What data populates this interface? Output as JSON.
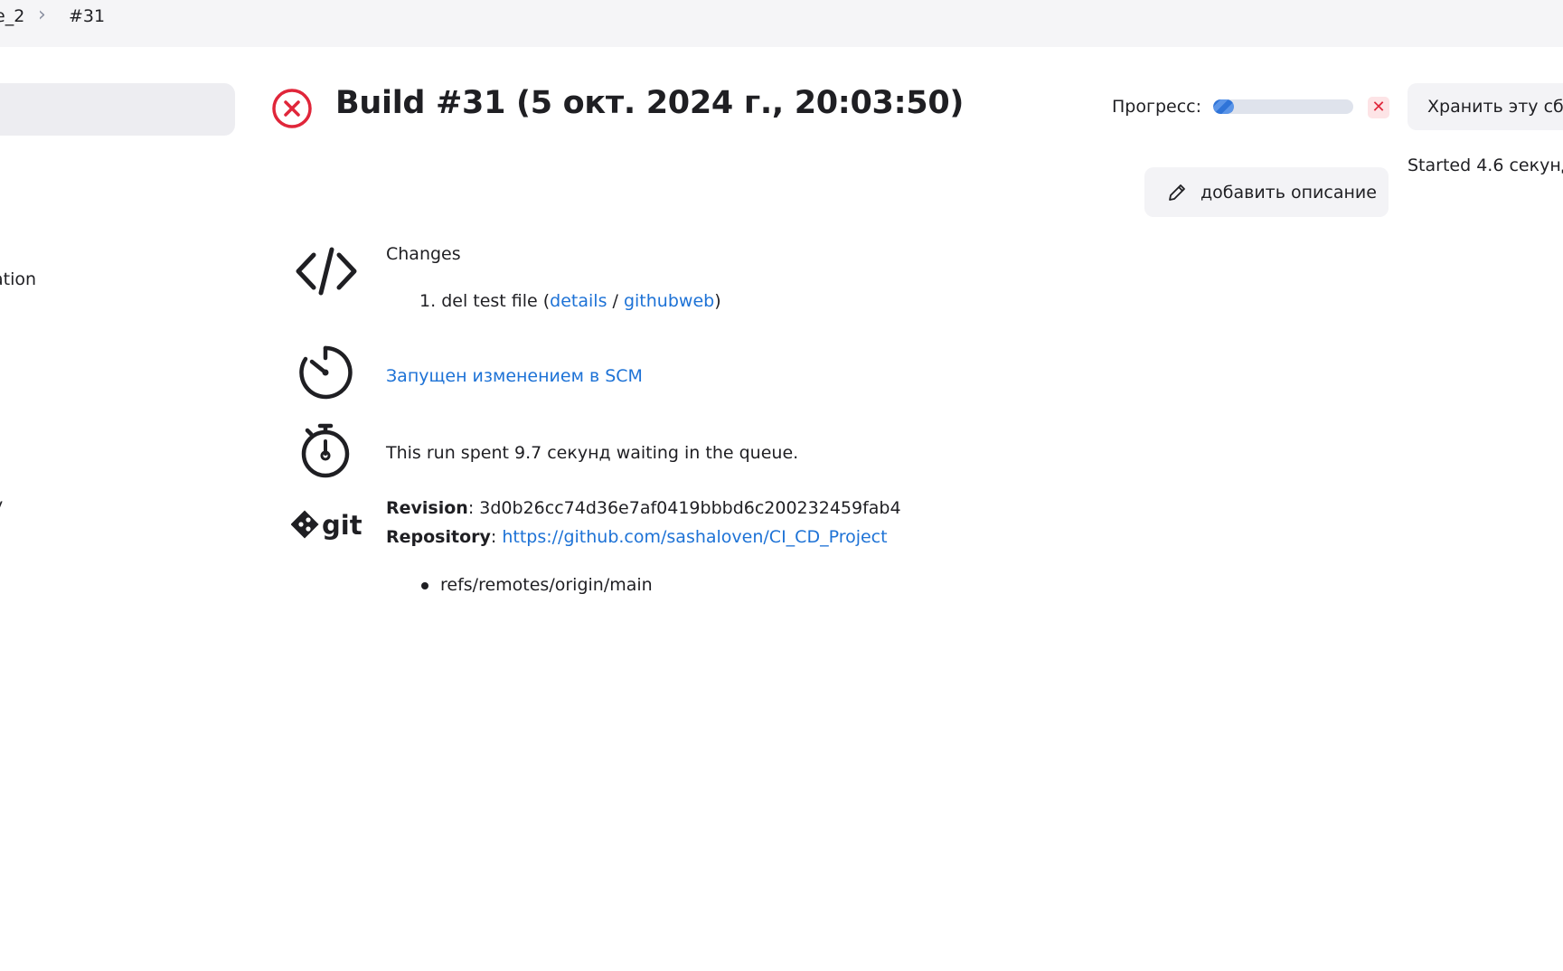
{
  "breadcrumb": {
    "job": "e_2",
    "separator": "›",
    "build": "#31"
  },
  "sidebar": {
    "items": [
      "ation",
      "y"
    ]
  },
  "header": {
    "title": "Build #31 (5 окт. 2024 г., 20:03:50)",
    "status": "failed",
    "status_color": "#e0263a"
  },
  "progress": {
    "label": "Прогресс:",
    "value_fraction": 0.15,
    "cancel_icon": "close-icon"
  },
  "actions": {
    "keep_build": "Хранить эту сбо",
    "add_description": "добавить описание",
    "add_description_icon": "pencil-icon"
  },
  "started": "Started 4.6 секунд",
  "changes": {
    "heading": "Changes",
    "items": [
      {
        "number": "1.",
        "message": "del test file (",
        "details_link": "details",
        "separator": " / ",
        "githubweb_link": "githubweb",
        "close": ")"
      }
    ]
  },
  "trigger": {
    "text": "Запущен изменением в SCM"
  },
  "queue": {
    "text": "This run spent 9.7 секунд waiting in the queue."
  },
  "git": {
    "logo_text": "git",
    "revision_label": "Revision",
    "revision_value": ": 3d0b26cc74d36e7af0419bbbd6c200232459fab4",
    "repository_label": "Repository",
    "repository_sep": ": ",
    "repository_url": "https://github.com/sashaloven/CI_CD_Project",
    "refs": [
      "refs/remotes/origin/main"
    ]
  },
  "colors": {
    "link": "#1d72d6",
    "error": "#e0263a",
    "breadcrumb_bg": "#f5f5f7"
  }
}
